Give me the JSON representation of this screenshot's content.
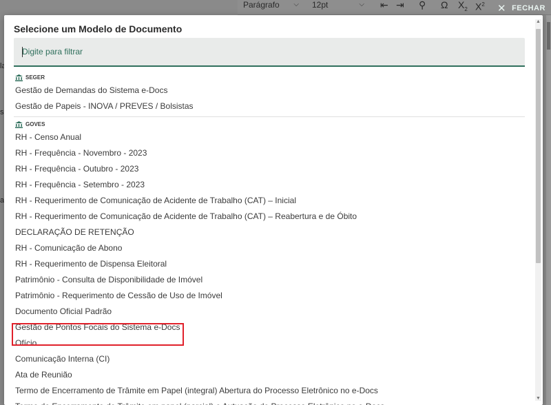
{
  "background": {
    "style_select": "Parágrafo",
    "size_select": "12pt",
    "close_label": "FECHAR",
    "left_glyphs": [
      "la",
      "s",
      "a"
    ]
  },
  "modal": {
    "title": "Selecione um Modelo de Documento",
    "filter_placeholder": "Digite para filtrar",
    "groups": [
      {
        "name": "SEGER",
        "items": [
          "Gestão de Demandas do Sistema e-Docs",
          "Gestão de Papeis - INOVA / PREVES / Bolsistas"
        ]
      },
      {
        "name": "GOVES",
        "items": [
          "RH - Censo Anual",
          "RH - Frequência - Novembro - 2023",
          "RH - Frequência - Outubro - 2023",
          "RH - Frequência - Setembro - 2023",
          "RH - Requerimento de Comunicação de Acidente de Trabalho (CAT) – Inicial",
          "RH - Requerimento de Comunicação de Acidente de Trabalho (CAT) – Reabertura e de Óbito",
          "DECLARAÇÃO DE RETENÇÃO",
          "RH - Comunicação de Abono",
          "RH - Requerimento de Dispensa Eleitoral",
          "Patrimônio - Consulta de Disponibilidade de Imóvel",
          "Patrimônio - Requerimento de Cessão de Uso de Imóvel",
          "Documento Oficial Padrão",
          "Gestão de Pontos Focais do Sistema e-Docs",
          "Ofício",
          "Comunicação Interna (CI)",
          "Ata de Reunião",
          "Termo de Encerramento de Trâmite em Papel (integral) Abertura do Processo Eletrônico no e-Docs",
          "Termo de Encerramento de Trâmite em papel (parcial) e Autuação de Processo Eletrônico no e-Docs"
        ]
      }
    ],
    "highlighted_item": "Gestão de Pontos Focais do Sistema e-Docs"
  },
  "colors": {
    "accent": "#2f6f5c",
    "highlight": "#e0202a"
  },
  "icons": [
    "building-icon",
    "close-icon",
    "chevron-down-icon",
    "omega-icon",
    "subscript-icon",
    "superscript-icon",
    "search-icon",
    "indent-icon",
    "outdent-icon"
  ]
}
